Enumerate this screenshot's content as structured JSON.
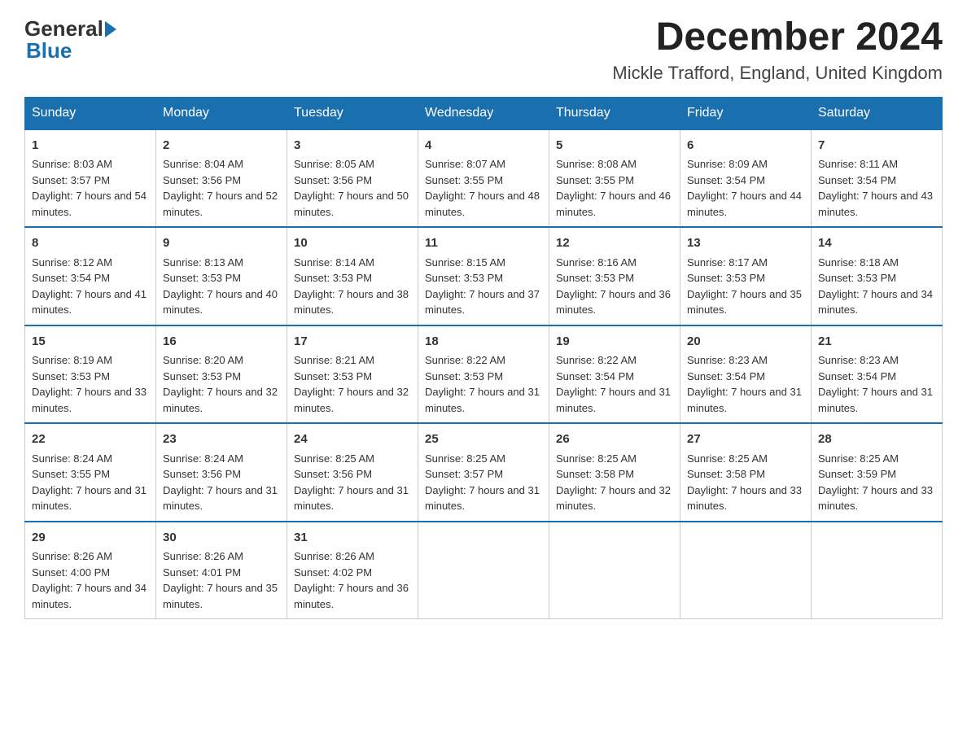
{
  "header": {
    "logo_general": "General",
    "logo_blue": "Blue",
    "month_title": "December 2024",
    "location": "Mickle Trafford, England, United Kingdom"
  },
  "days_of_week": [
    "Sunday",
    "Monday",
    "Tuesday",
    "Wednesday",
    "Thursday",
    "Friday",
    "Saturday"
  ],
  "weeks": [
    [
      {
        "day": "1",
        "sunrise": "8:03 AM",
        "sunset": "3:57 PM",
        "daylight": "7 hours and 54 minutes."
      },
      {
        "day": "2",
        "sunrise": "8:04 AM",
        "sunset": "3:56 PM",
        "daylight": "7 hours and 52 minutes."
      },
      {
        "day": "3",
        "sunrise": "8:05 AM",
        "sunset": "3:56 PM",
        "daylight": "7 hours and 50 minutes."
      },
      {
        "day": "4",
        "sunrise": "8:07 AM",
        "sunset": "3:55 PM",
        "daylight": "7 hours and 48 minutes."
      },
      {
        "day": "5",
        "sunrise": "8:08 AM",
        "sunset": "3:55 PM",
        "daylight": "7 hours and 46 minutes."
      },
      {
        "day": "6",
        "sunrise": "8:09 AM",
        "sunset": "3:54 PM",
        "daylight": "7 hours and 44 minutes."
      },
      {
        "day": "7",
        "sunrise": "8:11 AM",
        "sunset": "3:54 PM",
        "daylight": "7 hours and 43 minutes."
      }
    ],
    [
      {
        "day": "8",
        "sunrise": "8:12 AM",
        "sunset": "3:54 PM",
        "daylight": "7 hours and 41 minutes."
      },
      {
        "day": "9",
        "sunrise": "8:13 AM",
        "sunset": "3:53 PM",
        "daylight": "7 hours and 40 minutes."
      },
      {
        "day": "10",
        "sunrise": "8:14 AM",
        "sunset": "3:53 PM",
        "daylight": "7 hours and 38 minutes."
      },
      {
        "day": "11",
        "sunrise": "8:15 AM",
        "sunset": "3:53 PM",
        "daylight": "7 hours and 37 minutes."
      },
      {
        "day": "12",
        "sunrise": "8:16 AM",
        "sunset": "3:53 PM",
        "daylight": "7 hours and 36 minutes."
      },
      {
        "day": "13",
        "sunrise": "8:17 AM",
        "sunset": "3:53 PM",
        "daylight": "7 hours and 35 minutes."
      },
      {
        "day": "14",
        "sunrise": "8:18 AM",
        "sunset": "3:53 PM",
        "daylight": "7 hours and 34 minutes."
      }
    ],
    [
      {
        "day": "15",
        "sunrise": "8:19 AM",
        "sunset": "3:53 PM",
        "daylight": "7 hours and 33 minutes."
      },
      {
        "day": "16",
        "sunrise": "8:20 AM",
        "sunset": "3:53 PM",
        "daylight": "7 hours and 32 minutes."
      },
      {
        "day": "17",
        "sunrise": "8:21 AM",
        "sunset": "3:53 PM",
        "daylight": "7 hours and 32 minutes."
      },
      {
        "day": "18",
        "sunrise": "8:22 AM",
        "sunset": "3:53 PM",
        "daylight": "7 hours and 31 minutes."
      },
      {
        "day": "19",
        "sunrise": "8:22 AM",
        "sunset": "3:54 PM",
        "daylight": "7 hours and 31 minutes."
      },
      {
        "day": "20",
        "sunrise": "8:23 AM",
        "sunset": "3:54 PM",
        "daylight": "7 hours and 31 minutes."
      },
      {
        "day": "21",
        "sunrise": "8:23 AM",
        "sunset": "3:54 PM",
        "daylight": "7 hours and 31 minutes."
      }
    ],
    [
      {
        "day": "22",
        "sunrise": "8:24 AM",
        "sunset": "3:55 PM",
        "daylight": "7 hours and 31 minutes."
      },
      {
        "day": "23",
        "sunrise": "8:24 AM",
        "sunset": "3:56 PM",
        "daylight": "7 hours and 31 minutes."
      },
      {
        "day": "24",
        "sunrise": "8:25 AM",
        "sunset": "3:56 PM",
        "daylight": "7 hours and 31 minutes."
      },
      {
        "day": "25",
        "sunrise": "8:25 AM",
        "sunset": "3:57 PM",
        "daylight": "7 hours and 31 minutes."
      },
      {
        "day": "26",
        "sunrise": "8:25 AM",
        "sunset": "3:58 PM",
        "daylight": "7 hours and 32 minutes."
      },
      {
        "day": "27",
        "sunrise": "8:25 AM",
        "sunset": "3:58 PM",
        "daylight": "7 hours and 33 minutes."
      },
      {
        "day": "28",
        "sunrise": "8:25 AM",
        "sunset": "3:59 PM",
        "daylight": "7 hours and 33 minutes."
      }
    ],
    [
      {
        "day": "29",
        "sunrise": "8:26 AM",
        "sunset": "4:00 PM",
        "daylight": "7 hours and 34 minutes."
      },
      {
        "day": "30",
        "sunrise": "8:26 AM",
        "sunset": "4:01 PM",
        "daylight": "7 hours and 35 minutes."
      },
      {
        "day": "31",
        "sunrise": "8:26 AM",
        "sunset": "4:02 PM",
        "daylight": "7 hours and 36 minutes."
      },
      null,
      null,
      null,
      null
    ]
  ],
  "labels": {
    "sunrise_prefix": "Sunrise: ",
    "sunset_prefix": "Sunset: ",
    "daylight_prefix": "Daylight: "
  }
}
